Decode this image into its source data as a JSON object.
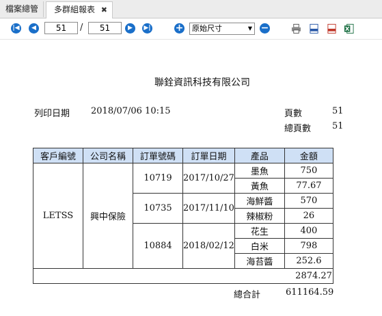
{
  "tabs": [
    {
      "label": "檔案總管"
    },
    {
      "label": "多群組報表",
      "close": "✖"
    }
  ],
  "toolbar": {
    "current_page": "51",
    "separator": "/",
    "total_pages": "51",
    "zoom": "原始尺寸",
    "export_icons": [
      "print-icon",
      "xml-icon",
      "pdf-icon",
      "excel-icon"
    ]
  },
  "report": {
    "company": "聯銓資訊科技有限公司",
    "print_date_label": "列印日期",
    "print_date": "2018/07/06 10:15",
    "page_label": "頁數",
    "page_value": "51",
    "total_page_label": "總頁數",
    "total_page_value": "51",
    "headers": [
      "客戶編號",
      "公司名稱",
      "訂單號碼",
      "訂單日期",
      "產品",
      "金額"
    ],
    "customer_id": "LETSS",
    "company_name": "興中保險",
    "orders": [
      {
        "no": "10719",
        "date": "2017/10/27",
        "items": [
          {
            "product": "墨魚",
            "amount": "750"
          },
          {
            "product": "黃魚",
            "amount": "77.67"
          }
        ]
      },
      {
        "no": "10735",
        "date": "2017/11/10",
        "items": [
          {
            "product": "海鮮醬",
            "amount": "570"
          },
          {
            "product": "辣椒粉",
            "amount": "26"
          }
        ]
      },
      {
        "no": "10884",
        "date": "2018/02/12",
        "items": [
          {
            "product": "花生",
            "amount": "400"
          },
          {
            "product": "白米",
            "amount": "798"
          },
          {
            "product": "海苔醬",
            "amount": "252.6"
          }
        ]
      }
    ],
    "subtotal": "2874.27",
    "grand_total_label": "總合計",
    "grand_total": "611164.59"
  }
}
